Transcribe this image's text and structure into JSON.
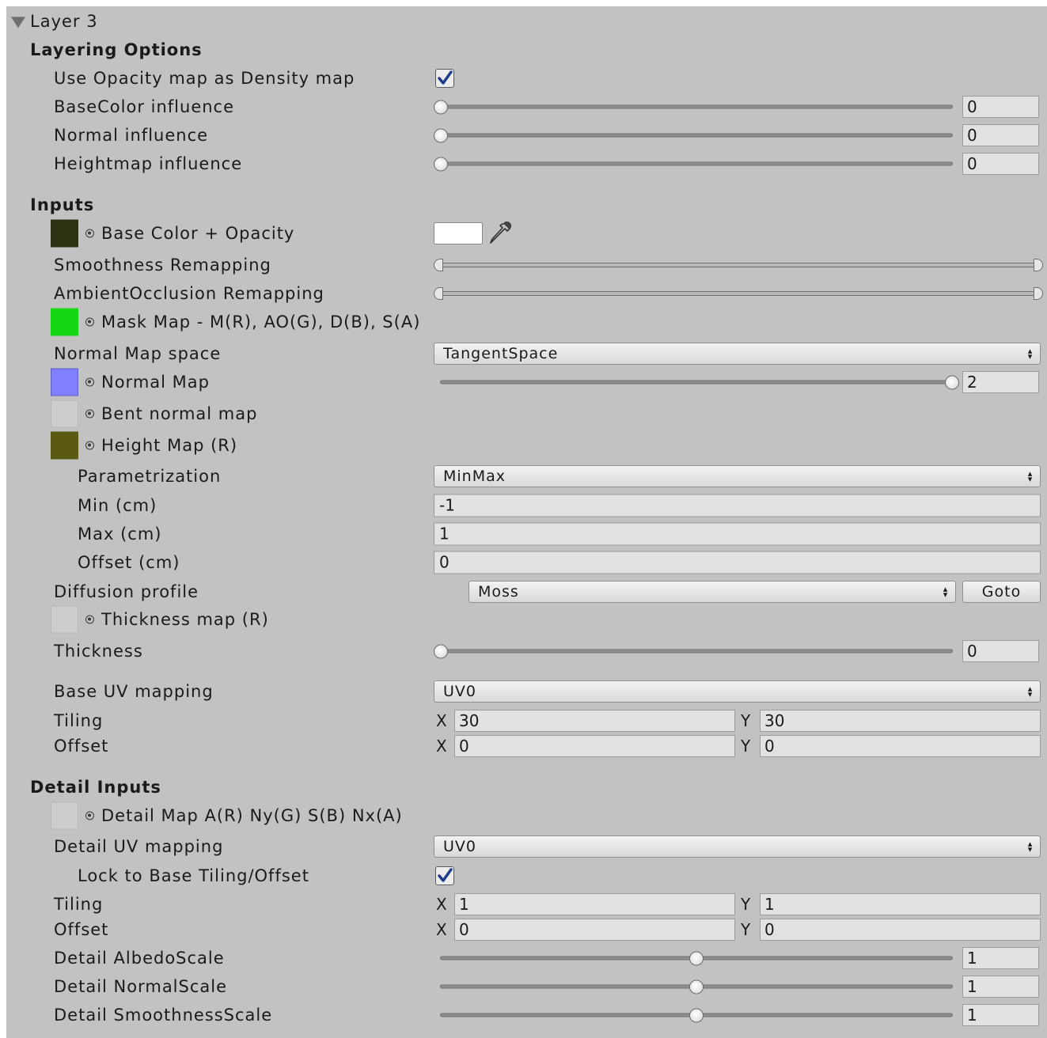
{
  "foldout": {
    "title": "Layer 3"
  },
  "layering": {
    "header": "Layering Options",
    "use_opacity": {
      "label": "Use Opacity map as Density map",
      "checked": true
    },
    "basecolor_influence": {
      "label": "BaseColor influence",
      "value": "0",
      "fraction": 0
    },
    "normal_influence": {
      "label": "Normal influence",
      "value": "0",
      "fraction": 0
    },
    "heightmap_influence": {
      "label": "Heightmap influence",
      "value": "0",
      "fraction": 0
    }
  },
  "inputs": {
    "header": "Inputs",
    "base_color": {
      "label": "Base Color + Opacity",
      "swatch": "#2c3312",
      "color": "#ffffff"
    },
    "smoothness_remapping": {
      "label": "Smoothness Remapping"
    },
    "ao_remapping": {
      "label": "AmbientOcclusion Remapping"
    },
    "mask_map": {
      "label": "Mask Map - M(R), AO(G), D(B), S(A)",
      "swatch": "#16d616"
    },
    "normal_space": {
      "label": "Normal Map space",
      "value": "TangentSpace"
    },
    "normal_map": {
      "label": "Normal Map",
      "swatch": "#8080ff",
      "value": "2",
      "fraction": 1
    },
    "bent_normal": {
      "label": "Bent normal map"
    },
    "height_map": {
      "label": "Height Map (R)",
      "swatch": "#5a5a14"
    },
    "parametrization": {
      "label": "Parametrization",
      "value": "MinMax"
    },
    "min": {
      "label": "Min (cm)",
      "value": "-1"
    },
    "max": {
      "label": "Max (cm)",
      "value": "1"
    },
    "offset_cm": {
      "label": "Offset (cm)",
      "value": "0"
    },
    "diffusion": {
      "label": "Diffusion profile",
      "value": "Moss",
      "goto": "Goto"
    },
    "thickness_map": {
      "label": "Thickness map (R)"
    },
    "thickness": {
      "label": "Thickness",
      "value": "0",
      "fraction": 0
    },
    "base_uv": {
      "label": "Base UV mapping",
      "value": "UV0"
    },
    "tiling": {
      "label": "Tiling",
      "x": "30",
      "y": "30"
    },
    "offset": {
      "label": "Offset",
      "x": "0",
      "y": "0"
    }
  },
  "detail": {
    "header": "Detail Inputs",
    "detail_map": {
      "label": "Detail Map A(R) Ny(G) S(B) Nx(A)"
    },
    "detail_uv": {
      "label": "Detail UV mapping",
      "value": "UV0"
    },
    "lock": {
      "label": "Lock to Base Tiling/Offset",
      "checked": true
    },
    "tiling": {
      "label": "Tiling",
      "x": "1",
      "y": "1"
    },
    "offset": {
      "label": "Offset",
      "x": "0",
      "y": "0"
    },
    "albedo_scale": {
      "label": "Detail AlbedoScale",
      "value": "1",
      "fraction": 0.5
    },
    "normal_scale": {
      "label": "Detail NormalScale",
      "value": "1",
      "fraction": 0.5
    },
    "smoothness_scale": {
      "label": "Detail SmoothnessScale",
      "value": "1",
      "fraction": 0.5
    }
  },
  "axis": {
    "x": "X",
    "y": "Y"
  }
}
